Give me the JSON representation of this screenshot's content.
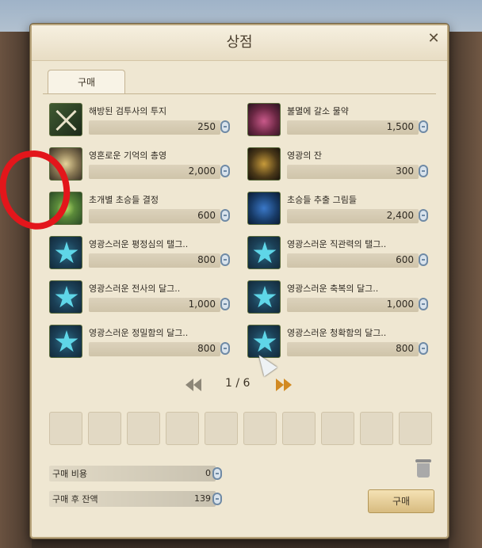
{
  "window": {
    "title": "상점",
    "close_icon": "close-icon"
  },
  "tabs": [
    {
      "label": "구매",
      "active": true
    }
  ],
  "items": [
    {
      "name": "해방된 검투사의 투지",
      "price": "250",
      "icon": "crossed-swords-icon",
      "color_class": "ic-green"
    },
    {
      "name": "불멸에 갈소 물약",
      "price": "1,500",
      "icon": "potion-icon",
      "color_class": "ic-pink"
    },
    {
      "name": "영혼로운 기억의 총영",
      "price": "2,000",
      "icon": "memory-icon",
      "color_class": "ic-brown"
    },
    {
      "name": "영광의 잔",
      "price": "300",
      "icon": "chalice-icon",
      "color_class": "ic-gold"
    },
    {
      "name": "초개별 초승들 결정",
      "price": "600",
      "icon": "orb-icon",
      "color_class": "ic-orb"
    },
    {
      "name": "초승들 추출 그림들",
      "price": "2,400",
      "icon": "moon-icon",
      "color_class": "ic-moon"
    },
    {
      "name": "영광스러운 평정심의 탤그..",
      "price": "800",
      "icon": "star-emblem-icon",
      "color_class": "ic-blue"
    },
    {
      "name": "영광스러운 직관력의 탤그..",
      "price": "600",
      "icon": "star-emblem-icon",
      "color_class": "ic-blue"
    },
    {
      "name": "영광스러운 전사의 달그..",
      "price": "1,000",
      "icon": "star-emblem-icon",
      "color_class": "ic-blue"
    },
    {
      "name": "영광스러운 축복의 달그..",
      "price": "1,000",
      "icon": "star-emblem-icon",
      "color_class": "ic-blue"
    },
    {
      "name": "영광스러운 정밀함의 달그..",
      "price": "800",
      "icon": "star-emblem-icon",
      "color_class": "ic-blue"
    },
    {
      "name": "영광스러운 청확함의 달그..",
      "price": "800",
      "icon": "star-emblem-icon",
      "color_class": "ic-blue"
    }
  ],
  "pagination": {
    "text": "1 / 6"
  },
  "summary": {
    "cost_label": "구매 비용",
    "cost_value": "0",
    "balance_label": "구매 후 잔액",
    "balance_value": "139"
  },
  "buy_button": "구매",
  "colors": {
    "highlight": "#e3161b",
    "panel": "#efe7d2",
    "accent": "#d28a22"
  }
}
